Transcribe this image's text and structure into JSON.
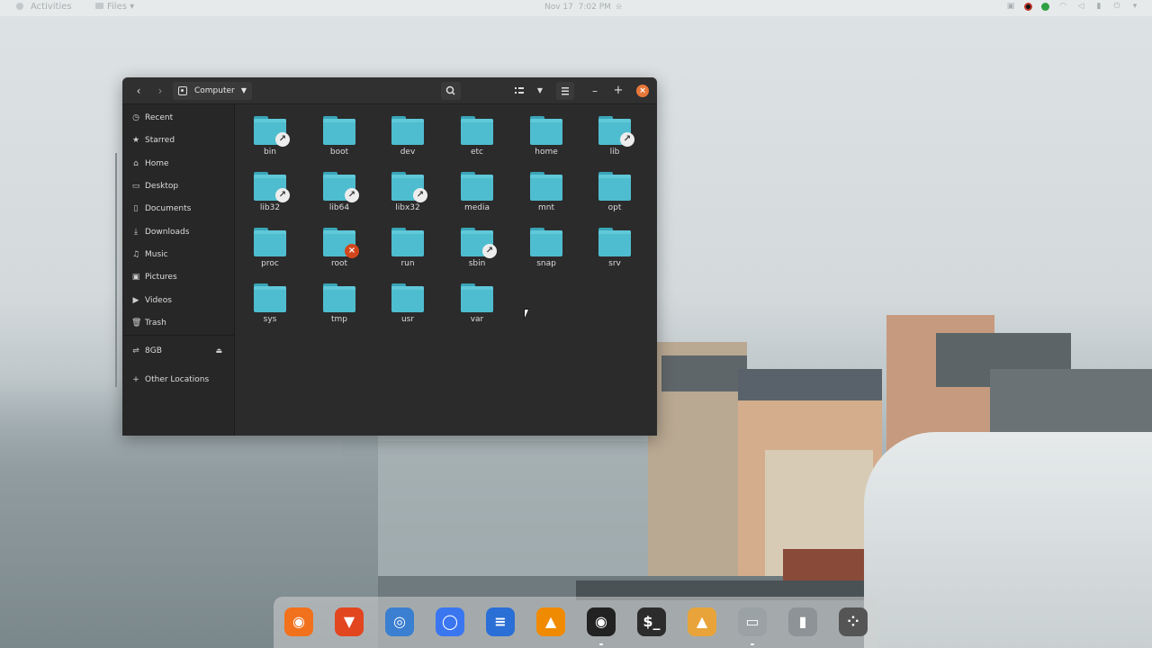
{
  "topbar": {
    "activities": "Activities",
    "app_menu": "Files",
    "date": "Nov 17",
    "time": "7:02 PM"
  },
  "window": {
    "path_label": "Computer",
    "close_color": "#e8783a"
  },
  "sidebar": {
    "items": [
      {
        "label": "Recent",
        "icon": "clock-icon"
      },
      {
        "label": "Starred",
        "icon": "star-icon"
      },
      {
        "label": "Home",
        "icon": "home-icon"
      },
      {
        "label": "Desktop",
        "icon": "desktop-icon"
      },
      {
        "label": "Documents",
        "icon": "document-icon"
      },
      {
        "label": "Downloads",
        "icon": "download-icon"
      },
      {
        "label": "Music",
        "icon": "music-icon"
      },
      {
        "label": "Pictures",
        "icon": "picture-icon"
      },
      {
        "label": "Videos",
        "icon": "video-icon"
      },
      {
        "label": "Trash",
        "icon": "trash-icon"
      }
    ],
    "drive": {
      "label": "8GB",
      "icon": "usb-icon"
    },
    "other_locations": "Other Locations"
  },
  "folders": [
    {
      "name": "bin",
      "badge": "link"
    },
    {
      "name": "boot",
      "badge": ""
    },
    {
      "name": "dev",
      "badge": ""
    },
    {
      "name": "etc",
      "badge": ""
    },
    {
      "name": "home",
      "badge": ""
    },
    {
      "name": "lib",
      "badge": "link"
    },
    {
      "name": "lib32",
      "badge": "link"
    },
    {
      "name": "lib64",
      "badge": "link"
    },
    {
      "name": "libx32",
      "badge": "link"
    },
    {
      "name": "media",
      "badge": ""
    },
    {
      "name": "mnt",
      "badge": ""
    },
    {
      "name": "opt",
      "badge": ""
    },
    {
      "name": "proc",
      "badge": ""
    },
    {
      "name": "root",
      "badge": "locked"
    },
    {
      "name": "run",
      "badge": ""
    },
    {
      "name": "sbin",
      "badge": "link"
    },
    {
      "name": "snap",
      "badge": ""
    },
    {
      "name": "srv",
      "badge": ""
    },
    {
      "name": "sys",
      "badge": ""
    },
    {
      "name": "tmp",
      "badge": ""
    },
    {
      "name": "usr",
      "badge": ""
    },
    {
      "name": "var",
      "badge": ""
    }
  ],
  "dock": [
    {
      "name": "firefox",
      "color": "#f2711c"
    },
    {
      "name": "brave",
      "color": "#e2461f"
    },
    {
      "name": "network-app",
      "color": "#3b7fd1"
    },
    {
      "name": "signal",
      "color": "#3a76f0"
    },
    {
      "name": "libreoffice-writer",
      "color": "#2a6fd6"
    },
    {
      "name": "vlc",
      "color": "#f08a00"
    },
    {
      "name": "obs",
      "color": "#222222"
    },
    {
      "name": "terminal",
      "color": "#2c2c2c"
    },
    {
      "name": "image-app",
      "color": "#e8a43a"
    },
    {
      "name": "files",
      "color": "#9aa2a5"
    },
    {
      "name": "trash",
      "color": "#8d9396"
    },
    {
      "name": "app-grid",
      "color": "#555555"
    }
  ]
}
